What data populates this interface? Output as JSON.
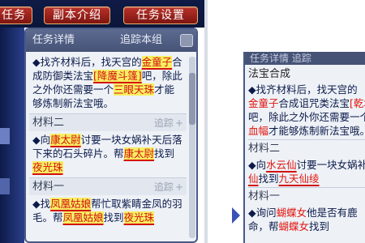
{
  "toolbar": {
    "btn1": "任务",
    "btn2": "副本介绍",
    "btn3": "任务设置"
  },
  "panel": {
    "title": "任务详情",
    "track_label": "追踪本组",
    "intro": {
      "a": "◆找齐材料后，找天宫的",
      "b": "金童子",
      "c": "合成防御类法宝",
      "d": "[降魔斗篷]",
      "e": "吧，除此之外你还需要一个",
      "f": "三眼天珠",
      "g": "才能够炼制新法宝哦。"
    },
    "m2": {
      "label": "材料二",
      "track": "追踪",
      "a": "◆向",
      "b": "康太尉",
      "c": "讨要一块女娲补天后落下来的石头碎片。帮",
      "d": "康太尉",
      "e": "找到",
      "f": "夜光珠"
    },
    "m1": {
      "label": "材料一",
      "track": "追踪",
      "a": "◆找",
      "b": "凤凰姑娘",
      "c": "帮忙取紫睛金凤的羽毛。帮",
      "d": "凤凰姑娘",
      "e": "找到",
      "f": "夜光珠"
    }
  },
  "right": {
    "head": "任务详情    追踪",
    "sub": "法宝合成",
    "intro": {
      "a": "◆找齐材料后，找天宫的",
      "b": "金童子",
      "c": "合成诅咒类法宝",
      "d": "[乾坤",
      "e": "吧，除此之外你还需要一个",
      "f": "血幅",
      "g": "才能够炼制新法宝哦。"
    },
    "m2": {
      "label": "材料二",
      "a": "◆向",
      "b": "水云仙",
      "c": "讨要一块女娲补天后落下来的石头碎片。帮",
      "d": "仙",
      "e": "找到",
      "f": "九天仙绫"
    },
    "m1": {
      "label": "材料一",
      "a": "◆询问",
      "b": "蝴蝶女",
      "c": "他是否有鹿",
      "d": "命，帮",
      "e": "蝴蝶女",
      "f": "找到"
    }
  },
  "colors": {
    "toolbar_bg": "#0f1b46",
    "button_red": "#b8322a",
    "button_border": "#e7b26c",
    "panel_bg": "#eef2f7",
    "header_bg": "#465377",
    "text_blue": "#0c1a4a",
    "text_red": "#e2140d"
  }
}
